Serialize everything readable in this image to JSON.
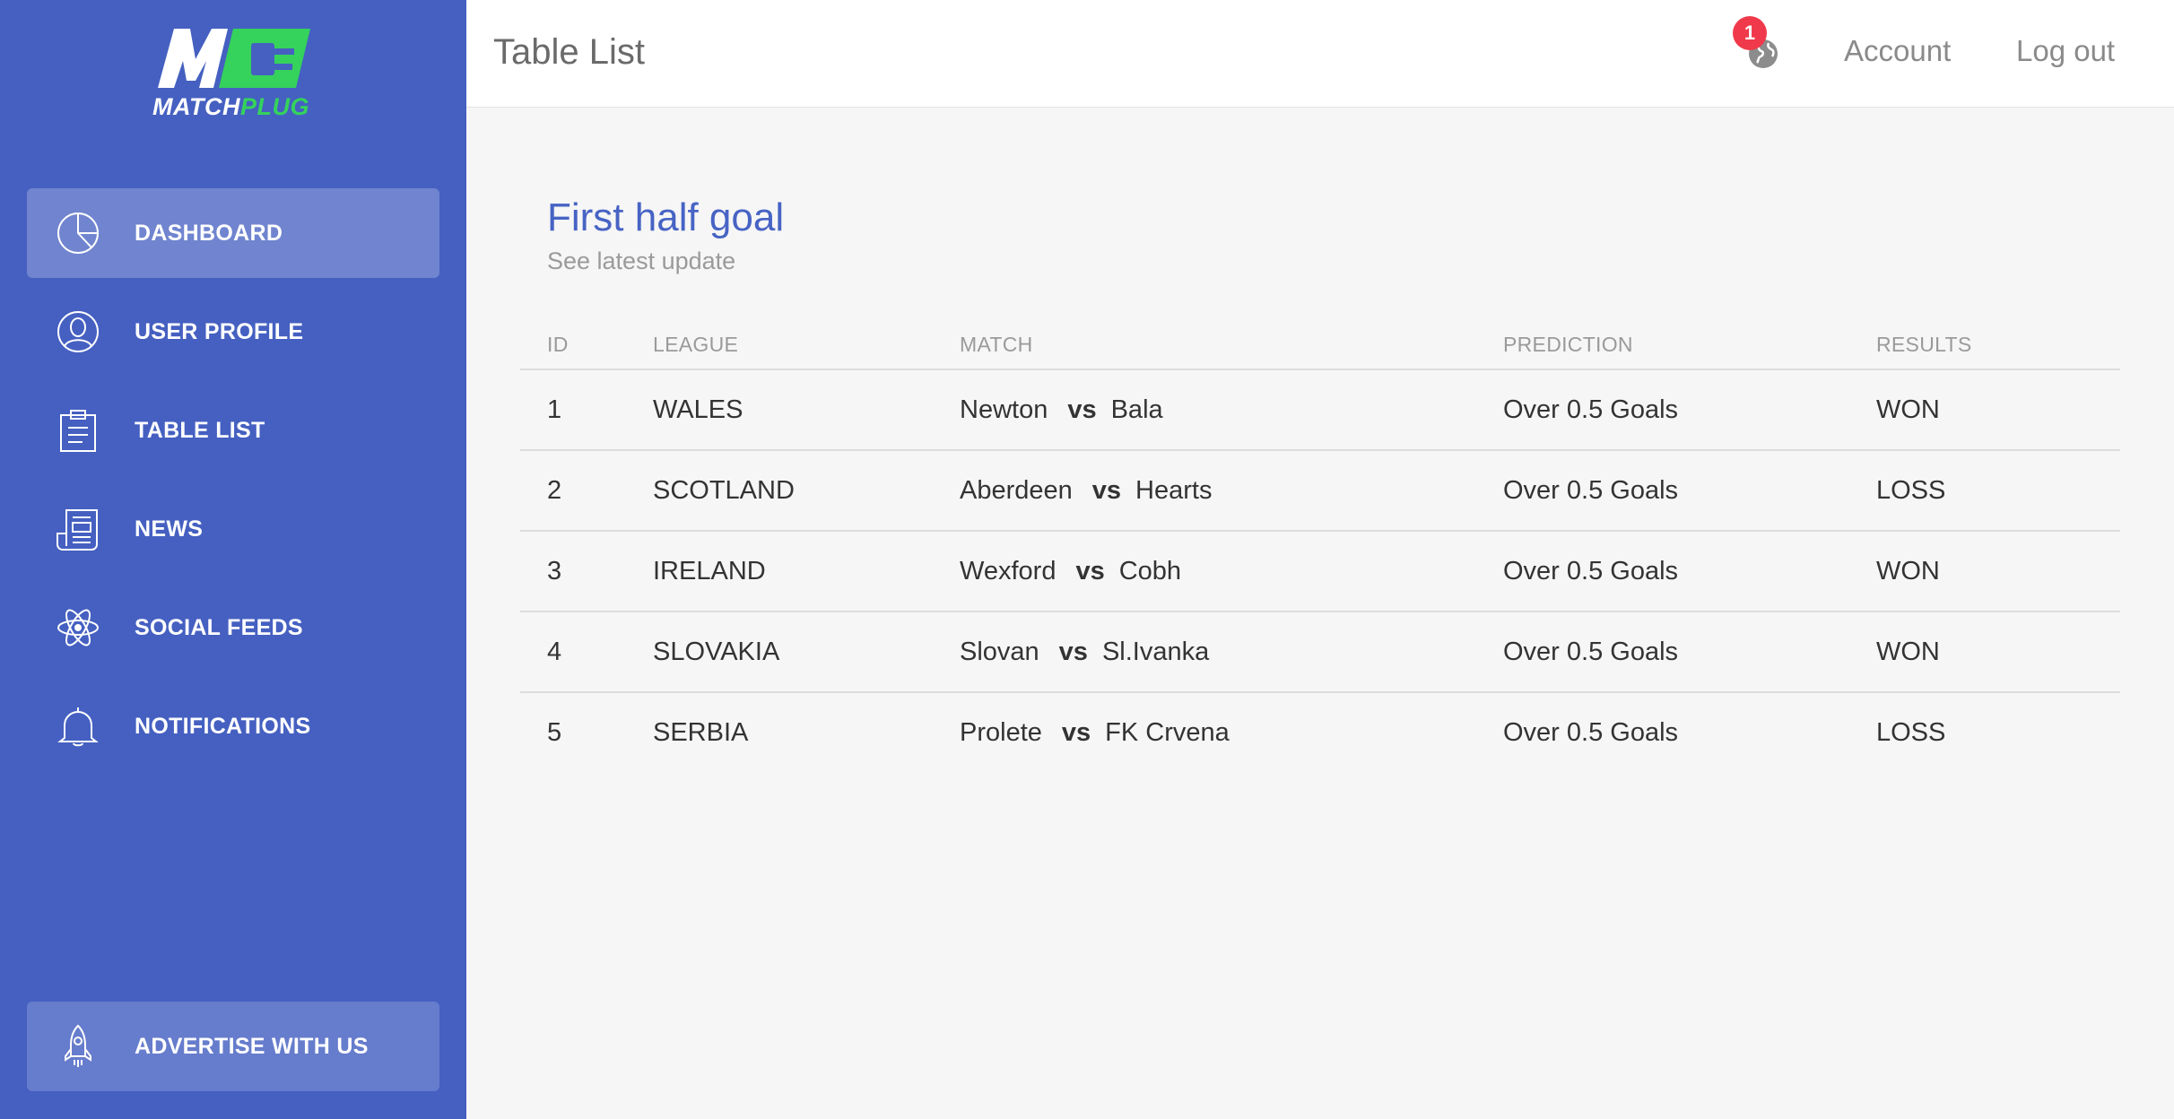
{
  "brand": {
    "logo_text_white": "MATCH",
    "logo_text_green": "PLUG",
    "colors": {
      "sidebar": "#4560c1",
      "accent_green": "#35d25c",
      "title_blue": "#4763c4",
      "badge_red": "#f0394a"
    }
  },
  "sidebar": {
    "items": [
      {
        "label": "DASHBOARD",
        "icon": "pie-chart-icon",
        "active": true
      },
      {
        "label": "USER PROFILE",
        "icon": "user-icon",
        "active": false
      },
      {
        "label": "TABLE LIST",
        "icon": "clipboard-icon",
        "active": false
      },
      {
        "label": "NEWS",
        "icon": "newspaper-icon",
        "active": false
      },
      {
        "label": "SOCIAL FEEDS",
        "icon": "atom-icon",
        "active": false
      },
      {
        "label": "NOTIFICATIONS",
        "icon": "bell-icon",
        "active": false
      }
    ],
    "bottom": {
      "label": "ADVERTISE WITH US",
      "icon": "rocket-icon"
    }
  },
  "header": {
    "title": "Table List",
    "notification_count": "1",
    "account": "Account",
    "logout": "Log out"
  },
  "card": {
    "title": "First half goal",
    "subtitle": "See latest update"
  },
  "table": {
    "columns": [
      "ID",
      "LEAGUE",
      "MATCH",
      "PREDICTION",
      "RESULTS"
    ],
    "vs_label": "vs",
    "rows": [
      {
        "id": "1",
        "league": "WALES",
        "home": "Newton",
        "away": "Bala",
        "prediction": "Over 0.5 Goals",
        "result": "WON"
      },
      {
        "id": "2",
        "league": "SCOTLAND",
        "home": "Aberdeen",
        "away": "Hearts",
        "prediction": "Over 0.5 Goals",
        "result": "LOSS"
      },
      {
        "id": "3",
        "league": "IRELAND",
        "home": "Wexford",
        "away": "Cobh",
        "prediction": "Over 0.5 Goals",
        "result": "WON"
      },
      {
        "id": "4",
        "league": "SLOVAKIA",
        "home": "Slovan",
        "away": "Sl.Ivanka",
        "prediction": "Over 0.5 Goals",
        "result": "WON"
      },
      {
        "id": "5",
        "league": "SERBIA",
        "home": "Prolete",
        "away": "FK Crvena",
        "prediction": "Over 0.5 Goals",
        "result": "LOSS"
      }
    ]
  }
}
